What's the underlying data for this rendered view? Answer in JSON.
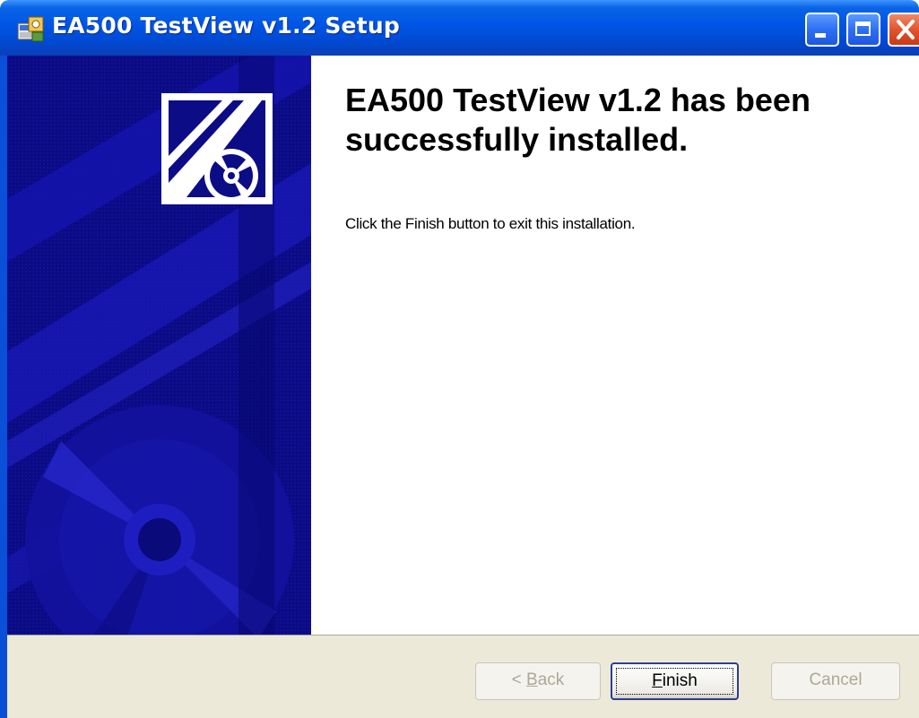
{
  "window": {
    "title": "EA500 TestView v1.2 Setup",
    "controls": [
      "minimize-icon",
      "maximize-icon",
      "close-icon"
    ]
  },
  "content": {
    "heading": "EA500 TestView v1.2 has been successfully installed.",
    "description": "Click the Finish button to exit this installation."
  },
  "buttons": {
    "back": {
      "prefix": "< ",
      "mnemonic": "B",
      "rest": "ack",
      "enabled": false
    },
    "finish": {
      "mnemonic": "F",
      "rest": "inish",
      "enabled": true
    },
    "cancel": {
      "label": "Cancel",
      "enabled": false
    }
  },
  "colors": {
    "titlebar": "#0055e5",
    "banner": "#0a0a7a",
    "buttonbar": "#ece9d8"
  }
}
